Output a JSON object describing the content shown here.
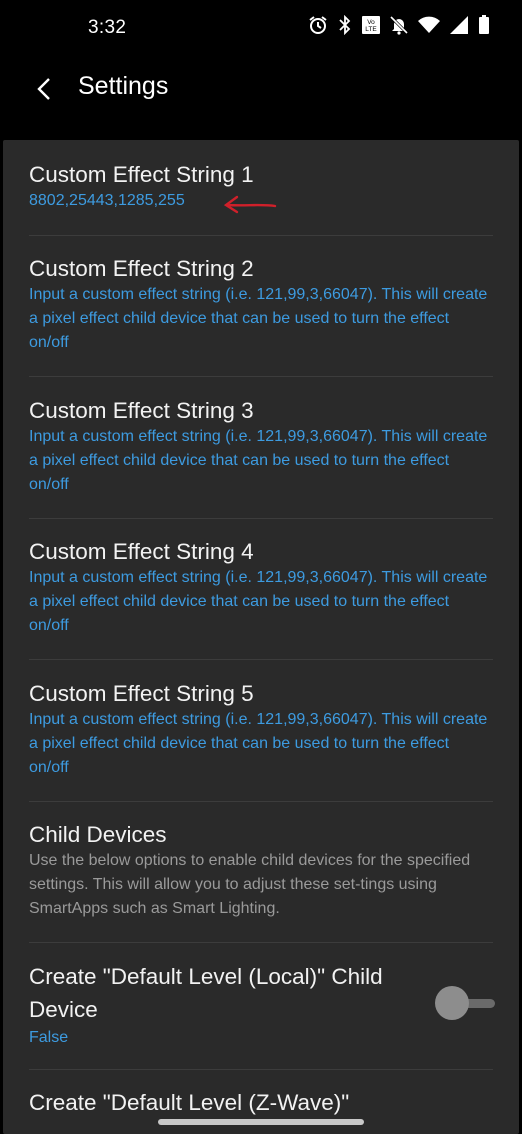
{
  "status": {
    "time": "3:32",
    "icons": [
      "alarm-icon",
      "bluetooth-icon",
      "volte-icon",
      "mute-icon",
      "wifi-icon",
      "signal-icon",
      "battery-icon"
    ]
  },
  "appbar": {
    "title": "Settings",
    "back_icon": "back-arrow-icon"
  },
  "items": [
    {
      "title": "Custom Effect String 1",
      "subtitle": "8802,25443,1285,255"
    },
    {
      "title": "Custom Effect String 2",
      "subtitle": "Input a custom effect string (i.e. 121,99,3,66047). This will create a pixel effect child device that can be used to turn the effect on/off"
    },
    {
      "title": "Custom Effect String 3",
      "subtitle": "Input a custom effect string (i.e. 121,99,3,66047). This will create a pixel effect child device that can be used to turn the effect on/off"
    },
    {
      "title": "Custom Effect String 4",
      "subtitle": "Input a custom effect string (i.e. 121,99,3,66047). This will create a pixel effect child device that can be used to turn the effect on/off"
    },
    {
      "title": "Custom Effect String 5",
      "subtitle": "Input a custom effect string (i.e. 121,99,3,66047). This will create a pixel effect child device that can be used to turn the effect on/off"
    },
    {
      "title": "Child Devices",
      "subtitle": "Use the below options to enable child devices for the specified settings. This will allow you to adjust these set-tings using SmartApps such as Smart Lighting."
    },
    {
      "title": "Create \"Default Level (Local)\" Child Device",
      "subtitle": "False",
      "toggle": false
    },
    {
      "title": "Create \"Default Level (Z-Wave)\""
    }
  ],
  "colors": {
    "background": "#000000",
    "sheet": "#2a2a2a",
    "accent": "#3d9be0",
    "annotation": "#d0202a"
  }
}
